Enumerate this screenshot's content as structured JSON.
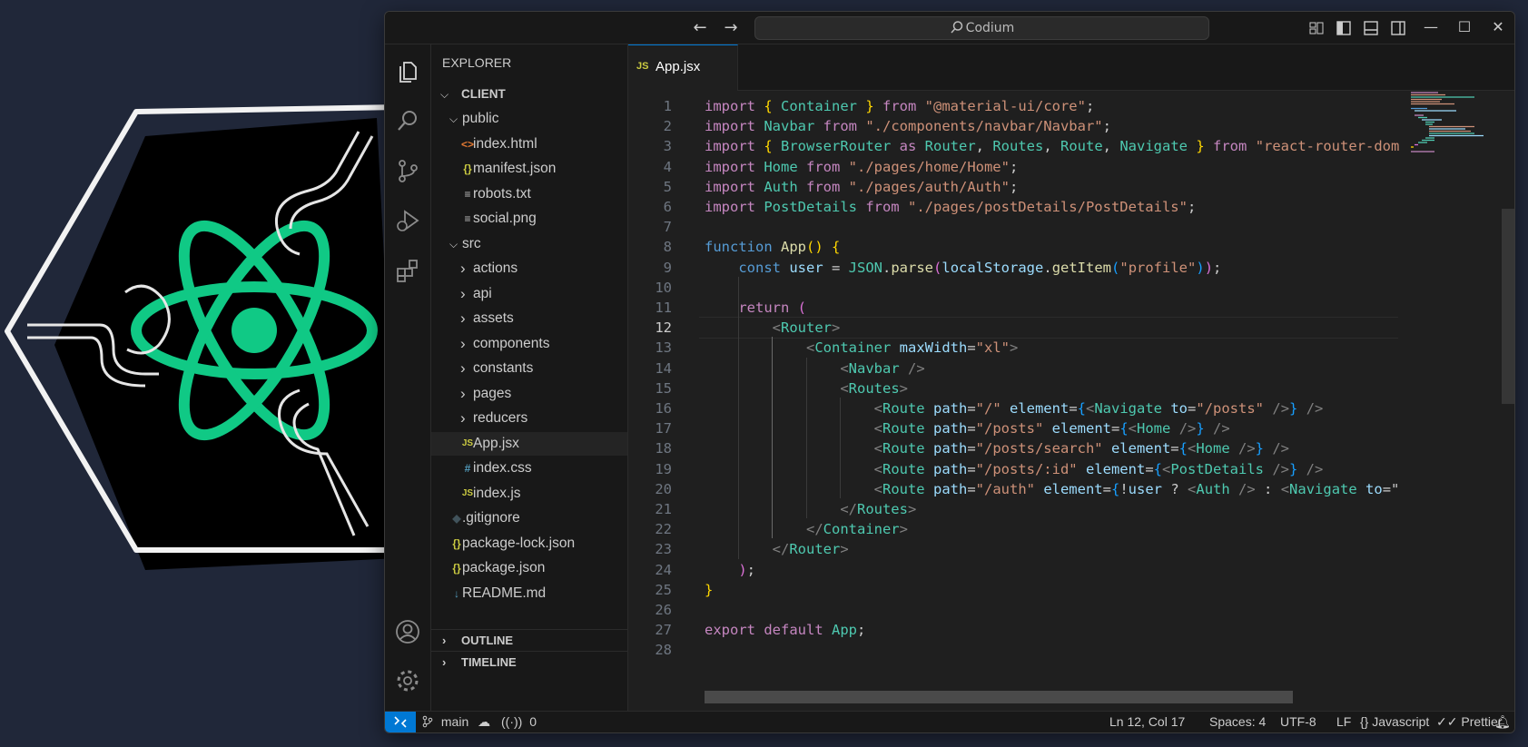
{
  "titlebar": {
    "search_text": "Codium",
    "back_icon": "arrow-left-icon",
    "forward_icon": "arrow-right-icon"
  },
  "explorer": {
    "title": "EXPLORER",
    "root": "CLIENT",
    "items": [
      {
        "label": "public",
        "kind": "folder-open",
        "depth": 1
      },
      {
        "label": "index.html",
        "kind": "html",
        "depth": 2
      },
      {
        "label": "manifest.json",
        "kind": "json",
        "depth": 2
      },
      {
        "label": "robots.txt",
        "kind": "text",
        "depth": 2
      },
      {
        "label": "social.png",
        "kind": "text",
        "depth": 2
      },
      {
        "label": "src",
        "kind": "folder-open",
        "depth": 1
      },
      {
        "label": "actions",
        "kind": "folder",
        "depth": 2
      },
      {
        "label": "api",
        "kind": "folder",
        "depth": 2
      },
      {
        "label": "assets",
        "kind": "folder",
        "depth": 2
      },
      {
        "label": "components",
        "kind": "folder",
        "depth": 2
      },
      {
        "label": "constants",
        "kind": "folder",
        "depth": 2
      },
      {
        "label": "pages",
        "kind": "folder",
        "depth": 2
      },
      {
        "label": "reducers",
        "kind": "folder",
        "depth": 2
      },
      {
        "label": "App.jsx",
        "kind": "js",
        "depth": 2
      },
      {
        "label": "index.css",
        "kind": "css",
        "depth": 2
      },
      {
        "label": "index.js",
        "kind": "js",
        "depth": 2
      },
      {
        "label": ".gitignore",
        "kind": "git",
        "depth": 1
      },
      {
        "label": "package-lock.json",
        "kind": "json",
        "depth": 1
      },
      {
        "label": "package.json",
        "kind": "json",
        "depth": 1
      },
      {
        "label": "README.md",
        "kind": "md",
        "depth": 1
      }
    ],
    "icon_glyphs": {
      "html": "<>",
      "json": "{}",
      "js": "JS",
      "css": "#",
      "text": "≡",
      "git": "◆",
      "md": "↓"
    },
    "icon_colors": {
      "html": "#e37933",
      "json": "#cbcb41",
      "js": "#cbcb41",
      "css": "#519aba",
      "text": "#bbbbbb",
      "git": "#41535b",
      "md": "#519aba"
    },
    "outline": "OUTLINE",
    "timeline": "TIMELINE"
  },
  "tab": {
    "icon": "JS",
    "label": "App.jsx"
  },
  "editor": {
    "current_line": 12,
    "lines": [
      [
        [
          "m",
          "import "
        ],
        [
          "b1",
          "{ "
        ],
        [
          "t",
          "Container "
        ],
        [
          "b1",
          "} "
        ],
        [
          "m",
          "from "
        ],
        [
          "s",
          "\"@material-ui/core\""
        ],
        [
          "w",
          ";"
        ]
      ],
      [
        [
          "m",
          "import "
        ],
        [
          "t",
          "Navbar "
        ],
        [
          "m",
          "from "
        ],
        [
          "s",
          "\"./components/navbar/Navbar\""
        ],
        [
          "w",
          ";"
        ]
      ],
      [
        [
          "m",
          "import "
        ],
        [
          "b1",
          "{ "
        ],
        [
          "t",
          "BrowserRouter "
        ],
        [
          "m",
          "as "
        ],
        [
          "t",
          "Router"
        ],
        [
          "w",
          ", "
        ],
        [
          "t",
          "Routes"
        ],
        [
          "w",
          ", "
        ],
        [
          "t",
          "Route"
        ],
        [
          "w",
          ", "
        ],
        [
          "t",
          "Navigate "
        ],
        [
          "b1",
          "} "
        ],
        [
          "m",
          "from "
        ],
        [
          "s",
          "\"react-router-dom"
        ]
      ],
      [
        [
          "m",
          "import "
        ],
        [
          "t",
          "Home "
        ],
        [
          "m",
          "from "
        ],
        [
          "s",
          "\"./pages/home/Home\""
        ],
        [
          "w",
          ";"
        ]
      ],
      [
        [
          "m",
          "import "
        ],
        [
          "t",
          "Auth "
        ],
        [
          "m",
          "from "
        ],
        [
          "s",
          "\"./pages/auth/Auth\""
        ],
        [
          "w",
          ";"
        ]
      ],
      [
        [
          "m",
          "import "
        ],
        [
          "t",
          "PostDetails "
        ],
        [
          "m",
          "from "
        ],
        [
          "s",
          "\"./pages/postDetails/PostDetails\""
        ],
        [
          "w",
          ";"
        ]
      ],
      [],
      [
        [
          "k",
          "function "
        ],
        [
          "f",
          "App"
        ],
        [
          "b1",
          "() {"
        ]
      ],
      [
        [
          "w",
          "    "
        ],
        [
          "k",
          "const "
        ],
        [
          "v",
          "user "
        ],
        [
          "w",
          "= "
        ],
        [
          "t",
          "JSON"
        ],
        [
          "w",
          "."
        ],
        [
          "f",
          "parse"
        ],
        [
          "b2",
          "("
        ],
        [
          "v",
          "localStorage"
        ],
        [
          "w",
          "."
        ],
        [
          "f",
          "getItem"
        ],
        [
          "b3",
          "("
        ],
        [
          "s",
          "\"profile\""
        ],
        [
          "b3",
          ")"
        ],
        [
          "b2",
          ")"
        ],
        [
          "w",
          ";"
        ]
      ],
      [],
      [
        [
          "w",
          "    "
        ],
        [
          "m",
          "return "
        ],
        [
          "b2",
          "("
        ]
      ],
      [
        [
          "w",
          "        "
        ],
        [
          "p",
          "<"
        ],
        [
          "t",
          "Router"
        ],
        [
          "p",
          ">"
        ]
      ],
      [
        [
          "w",
          "            "
        ],
        [
          "p",
          "<"
        ],
        [
          "t",
          "Container "
        ],
        [
          "v",
          "maxWidth"
        ],
        [
          "w",
          "="
        ],
        [
          "s",
          "\"xl\""
        ],
        [
          "p",
          ">"
        ]
      ],
      [
        [
          "w",
          "                "
        ],
        [
          "p",
          "<"
        ],
        [
          "t",
          "Navbar "
        ],
        [
          "p",
          "/>"
        ]
      ],
      [
        [
          "w",
          "                "
        ],
        [
          "p",
          "<"
        ],
        [
          "t",
          "Routes"
        ],
        [
          "p",
          ">"
        ]
      ],
      [
        [
          "w",
          "                    "
        ],
        [
          "p",
          "<"
        ],
        [
          "t",
          "Route "
        ],
        [
          "v",
          "path"
        ],
        [
          "w",
          "="
        ],
        [
          "s",
          "\"/\" "
        ],
        [
          "v",
          "element"
        ],
        [
          "w",
          "="
        ],
        [
          "b3",
          "{"
        ],
        [
          "p",
          "<"
        ],
        [
          "t",
          "Navigate "
        ],
        [
          "v",
          "to"
        ],
        [
          "w",
          "="
        ],
        [
          "s",
          "\"/posts\" "
        ],
        [
          "p",
          "/>"
        ],
        [
          "b3",
          "} "
        ],
        [
          "p",
          "/>"
        ]
      ],
      [
        [
          "w",
          "                    "
        ],
        [
          "p",
          "<"
        ],
        [
          "t",
          "Route "
        ],
        [
          "v",
          "path"
        ],
        [
          "w",
          "="
        ],
        [
          "s",
          "\"/posts\" "
        ],
        [
          "v",
          "element"
        ],
        [
          "w",
          "="
        ],
        [
          "b3",
          "{"
        ],
        [
          "p",
          "<"
        ],
        [
          "t",
          "Home "
        ],
        [
          "p",
          "/>"
        ],
        [
          "b3",
          "} "
        ],
        [
          "p",
          "/>"
        ]
      ],
      [
        [
          "w",
          "                    "
        ],
        [
          "p",
          "<"
        ],
        [
          "t",
          "Route "
        ],
        [
          "v",
          "path"
        ],
        [
          "w",
          "="
        ],
        [
          "s",
          "\"/posts/search\" "
        ],
        [
          "v",
          "element"
        ],
        [
          "w",
          "="
        ],
        [
          "b3",
          "{"
        ],
        [
          "p",
          "<"
        ],
        [
          "t",
          "Home "
        ],
        [
          "p",
          "/>"
        ],
        [
          "b3",
          "} "
        ],
        [
          "p",
          "/>"
        ]
      ],
      [
        [
          "w",
          "                    "
        ],
        [
          "p",
          "<"
        ],
        [
          "t",
          "Route "
        ],
        [
          "v",
          "path"
        ],
        [
          "w",
          "="
        ],
        [
          "s",
          "\"/posts/:id\" "
        ],
        [
          "v",
          "element"
        ],
        [
          "w",
          "="
        ],
        [
          "b3",
          "{"
        ],
        [
          "p",
          "<"
        ],
        [
          "t",
          "PostDetails "
        ],
        [
          "p",
          "/>"
        ],
        [
          "b3",
          "} "
        ],
        [
          "p",
          "/>"
        ]
      ],
      [
        [
          "w",
          "                    "
        ],
        [
          "p",
          "<"
        ],
        [
          "t",
          "Route "
        ],
        [
          "v",
          "path"
        ],
        [
          "w",
          "="
        ],
        [
          "s",
          "\"/auth\" "
        ],
        [
          "v",
          "element"
        ],
        [
          "w",
          "="
        ],
        [
          "b3",
          "{"
        ],
        [
          "w",
          "!"
        ],
        [
          "v",
          "user "
        ],
        [
          "w",
          "? "
        ],
        [
          "p",
          "<"
        ],
        [
          "t",
          "Auth "
        ],
        [
          "p",
          "/> "
        ],
        [
          "w",
          ": "
        ],
        [
          "p",
          "<"
        ],
        [
          "t",
          "Navigate "
        ],
        [
          "v",
          "to"
        ],
        [
          "w",
          "=\""
        ]
      ],
      [
        [
          "w",
          "                "
        ],
        [
          "p",
          "</"
        ],
        [
          "t",
          "Routes"
        ],
        [
          "p",
          ">"
        ]
      ],
      [
        [
          "w",
          "            "
        ],
        [
          "p",
          "</"
        ],
        [
          "t",
          "Container"
        ],
        [
          "p",
          ">"
        ]
      ],
      [
        [
          "w",
          "        "
        ],
        [
          "p",
          "</"
        ],
        [
          "t",
          "Router"
        ],
        [
          "p",
          ">"
        ]
      ],
      [
        [
          "w",
          "    "
        ],
        [
          "b2",
          ")"
        ],
        [
          "w",
          ";"
        ]
      ],
      [
        [
          "b1",
          "}"
        ]
      ],
      [],
      [
        [
          "m",
          "export "
        ],
        [
          "m",
          "default "
        ],
        [
          "t",
          "App"
        ],
        [
          "w",
          ";"
        ]
      ],
      []
    ]
  },
  "statusbar": {
    "branch": "main",
    "ports": "0",
    "position": "Ln 12, Col 17",
    "spaces": "Spaces: 4",
    "encoding": "UTF-8",
    "eol": "LF",
    "language": "Javascript",
    "formatter": "Prettier"
  },
  "colors": {
    "accent": "#0078d4",
    "react_green": "#10c985"
  }
}
